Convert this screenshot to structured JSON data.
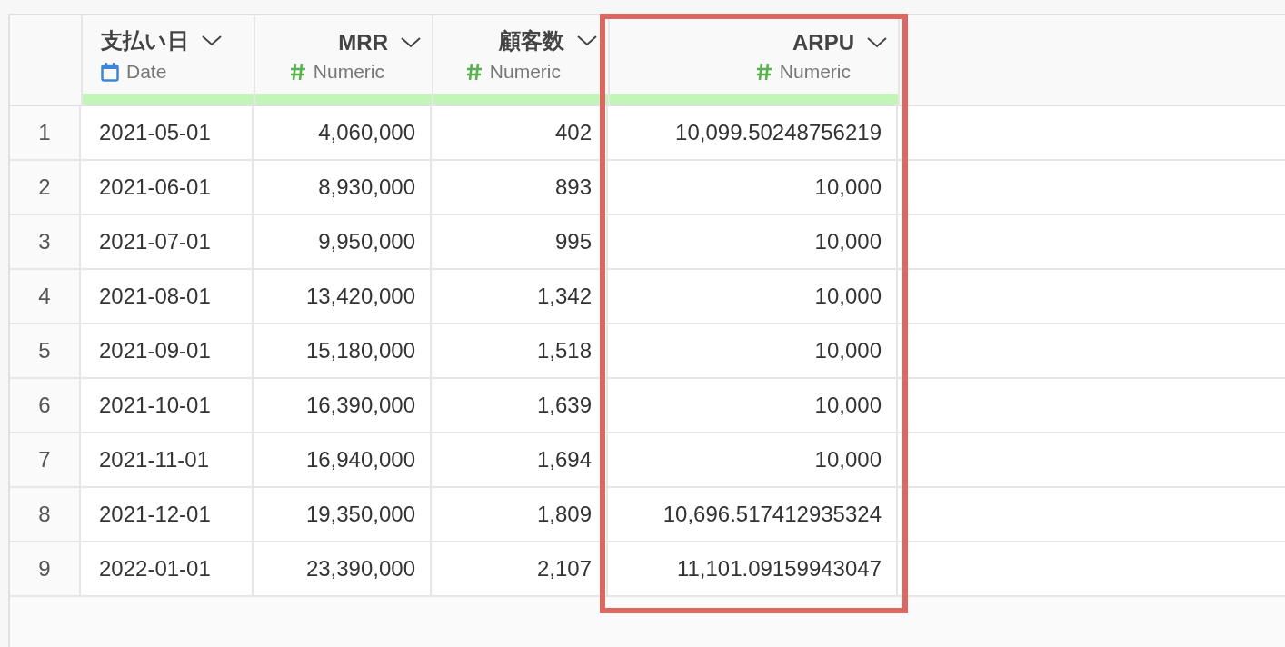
{
  "table": {
    "columns": [
      {
        "title": "支払い日",
        "type_label": "Date",
        "kind": "date",
        "highlighted": false
      },
      {
        "title": "MRR",
        "type_label": "Numeric",
        "kind": "numeric",
        "highlighted": false
      },
      {
        "title": "顧客数",
        "type_label": "Numeric",
        "kind": "numeric",
        "highlighted": false
      },
      {
        "title": "ARPU",
        "type_label": "Numeric",
        "kind": "numeric",
        "highlighted": true
      }
    ],
    "rows": [
      {
        "number": "1",
        "cells": [
          "2021-05-01",
          "4,060,000",
          "402",
          "10,099.50248756219"
        ]
      },
      {
        "number": "2",
        "cells": [
          "2021-06-01",
          "8,930,000",
          "893",
          "10,000"
        ]
      },
      {
        "number": "3",
        "cells": [
          "2021-07-01",
          "9,950,000",
          "995",
          "10,000"
        ]
      },
      {
        "number": "4",
        "cells": [
          "2021-08-01",
          "13,420,000",
          "1,342",
          "10,000"
        ]
      },
      {
        "number": "5",
        "cells": [
          "2021-09-01",
          "15,180,000",
          "1,518",
          "10,000"
        ]
      },
      {
        "number": "6",
        "cells": [
          "2021-10-01",
          "16,390,000",
          "1,639",
          "10,000"
        ]
      },
      {
        "number": "7",
        "cells": [
          "2021-11-01",
          "16,940,000",
          "1,694",
          "10,000"
        ]
      },
      {
        "number": "8",
        "cells": [
          "2021-12-01",
          "19,350,000",
          "1,809",
          "10,696.517412935324"
        ]
      },
      {
        "number": "9",
        "cells": [
          "2022-01-01",
          "23,390,000",
          "2,107",
          "11,101.09159943047"
        ]
      }
    ]
  }
}
